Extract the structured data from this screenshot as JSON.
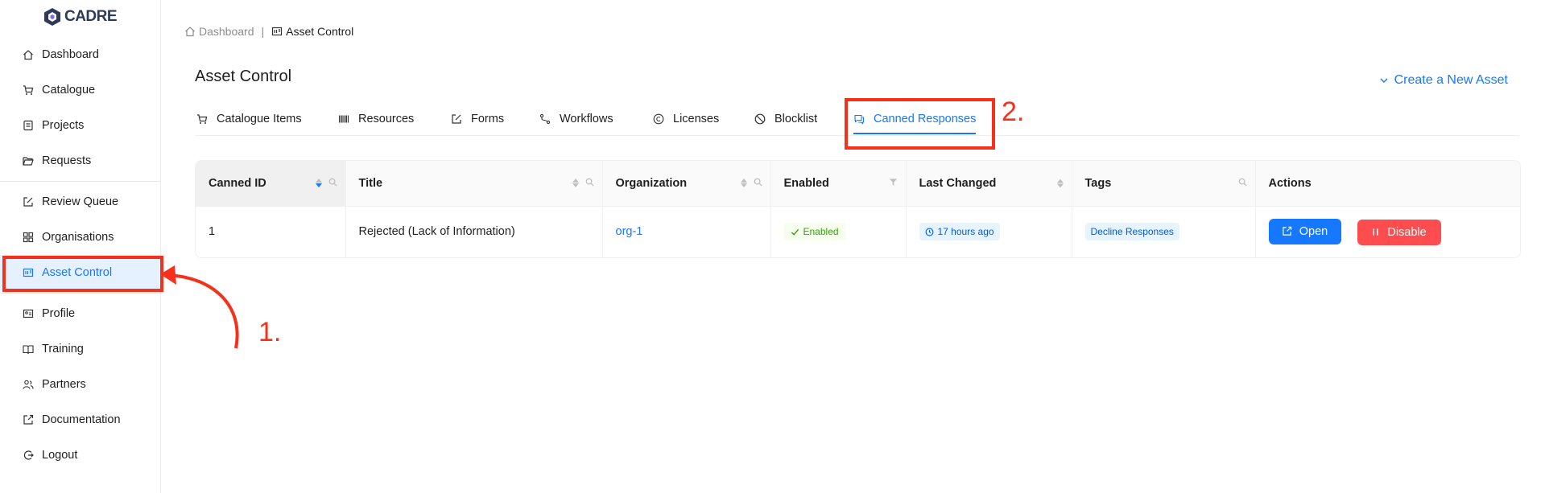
{
  "sidebar": {
    "logo_text": "CADRE",
    "items": [
      {
        "label": "Dashboard",
        "icon": "home-icon"
      },
      {
        "label": "Catalogue",
        "icon": "cart-icon"
      },
      {
        "label": "Projects",
        "icon": "project-icon"
      },
      {
        "label": "Requests",
        "icon": "folder-open-icon"
      },
      {
        "label": "Review Queue",
        "icon": "edit-icon"
      },
      {
        "label": "Organisations",
        "icon": "grid-icon"
      },
      {
        "label": "Asset Control",
        "icon": "asset-icon",
        "active": true
      },
      {
        "label": "Profile",
        "icon": "id-card-icon"
      },
      {
        "label": "Training",
        "icon": "book-icon"
      },
      {
        "label": "Partners",
        "icon": "team-icon"
      },
      {
        "label": "Documentation",
        "icon": "export-icon"
      },
      {
        "label": "Logout",
        "icon": "logout-icon"
      }
    ]
  },
  "breadcrumb": {
    "home": "Dashboard",
    "separator": "|",
    "current": "Asset Control"
  },
  "page": {
    "title": "Asset Control",
    "create_label": "Create a New Asset"
  },
  "tabs": [
    {
      "label": "Catalogue Items",
      "icon": "cart-icon"
    },
    {
      "label": "Resources",
      "icon": "barcode-icon"
    },
    {
      "label": "Forms",
      "icon": "edit-icon"
    },
    {
      "label": "Workflows",
      "icon": "branches-icon"
    },
    {
      "label": "Licenses",
      "icon": "copyright-icon"
    },
    {
      "label": "Blocklist",
      "icon": "stop-icon"
    },
    {
      "label": "Canned Responses",
      "icon": "comment-icon",
      "active": true
    }
  ],
  "table": {
    "columns": [
      "Canned ID",
      "Title",
      "Organization",
      "Enabled",
      "Last Changed",
      "Tags",
      "Actions"
    ],
    "rows": [
      {
        "id": "1",
        "title": "Rejected (Lack of Information)",
        "organization": "org-1",
        "enabled": "Enabled",
        "last_changed": "17 hours ago",
        "tags": "Decline Responses",
        "open_label": "Open",
        "disable_label": "Disable"
      }
    ]
  },
  "annotations": {
    "step1": "1.",
    "step2": "2."
  },
  "colors": {
    "accent": "#1677ff",
    "danger": "#ff4d4f",
    "annotation": "#f5301b",
    "active_bg": "#e6f1ff"
  }
}
